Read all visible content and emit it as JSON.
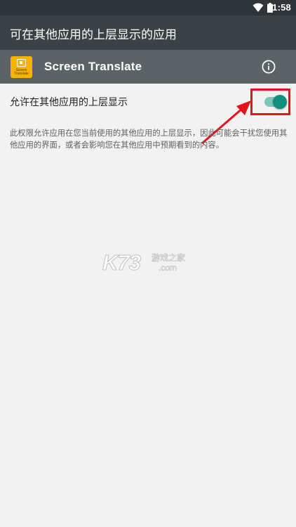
{
  "status_bar": {
    "time": "11:58",
    "icons": [
      "wifi-icon",
      "battery-icon"
    ]
  },
  "app_bar": {
    "title": "可在其他应用的上层显示的应用"
  },
  "app_header": {
    "app_name": "Screen Translate",
    "app_icon_text_line1": "Screen",
    "app_icon_text_line2": "Translate",
    "info_icon": "info-icon"
  },
  "setting": {
    "label": "允许在其他应用的上层显示",
    "enabled": true,
    "description": "此权限允许应用在您当前使用的其他应用的上层显示，因此可能会干扰您使用其他应用的界面，或者会影响您在其他应用中预期看到的内容。"
  },
  "watermark": {
    "brand": "K73",
    "chinese": "游戏之家",
    "domain": ".com"
  },
  "colors": {
    "status_bar": "#2f3439",
    "app_bar": "#3b4247",
    "app_header": "#5b6367",
    "toggle_thumb": "#0f8f7c",
    "toggle_track": "#7ec5b9",
    "annotation_red": "#e5121e",
    "app_icon": "#f4b400"
  }
}
